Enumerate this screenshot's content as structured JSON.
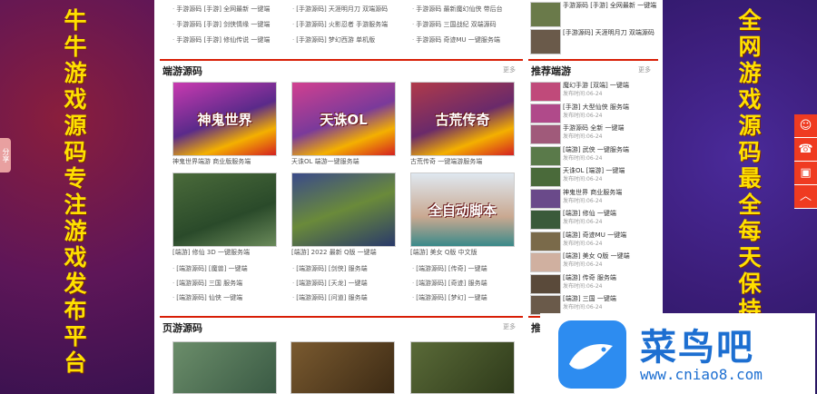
{
  "left_ad": "牛牛游戏源码专注游戏发布平台",
  "right_ad": "全网游戏源码最全每天保持",
  "share_label": "分享",
  "top_list": [
    "手游源码 [手游] 全网最新 一键端",
    "[手游源码] 天涯明月刀 双端源码",
    "手游源码 最新魔幻仙侠 带后台",
    "手游源码 [手游] 剑侠情缘 一键端",
    "[手游源码] 火影忍者 手游服务端",
    "手游源码 三国战纪 双端源码",
    "手游源码 [手游] 修仙传说 一键端",
    "[手游源码] 梦幻西游 单机版",
    "手游源码 奇迹MU 一键服务端"
  ],
  "section1": {
    "title": "端游源码",
    "more": "更多",
    "thumbs": [
      {
        "name": "神鬼世界",
        "caption": "神鬼世界端游 商业版服务端"
      },
      {
        "name": "天诛OL",
        "caption": "天诛OL 端游一键服务端"
      },
      {
        "name": "古荒传奇",
        "caption": "古荒传奇 一键端游服务端"
      },
      {
        "name": "",
        "caption": "[端游] 修仙 3D 一键服务端"
      },
      {
        "name": "",
        "caption": "[端游] 2022 最新 Q版 一键端"
      },
      {
        "name": "全自动脚本",
        "caption": "[端游] 美女 Q版 中文版"
      }
    ]
  },
  "section1_list": [
    "[端游源码] [魔兽] 一键端",
    "[端游源码] [剑侠] 服务端",
    "[端游源码] [传奇] 一键端",
    "[端游源码] 三国 服务端",
    "[端游源码] [天龙] 一键端",
    "[端游源码] [奇迹] 服务端",
    "[端游源码] 仙侠 一键端",
    "[端游源码] [问道] 服务端",
    "[端游源码] [梦幻] 一键端"
  ],
  "section2": {
    "title": "页游源码",
    "more": "更多"
  },
  "side": {
    "title": "推荐端游",
    "title2": "推荐",
    "items": [
      {
        "t": "魔幻手游 [双端] 一键端",
        "s": "发布时间:06-24"
      },
      {
        "t": "[手游] 大型仙侠 服务端",
        "s": "发布时间:06-24"
      },
      {
        "t": "手游源码 全新 一键端",
        "s": "发布时间:06-24"
      },
      {
        "t": "[端游] 武侠 一键服务端",
        "s": "发布时间:06-24"
      },
      {
        "t": "天诛OL [端游] 一键端",
        "s": "发布时间:06-24"
      },
      {
        "t": "神鬼世界 商业服务端",
        "s": "发布时间:06-24"
      },
      {
        "t": "[端游] 修仙 一键端",
        "s": "发布时间:06-24"
      },
      {
        "t": "[端游] 奇迹MU 一键端",
        "s": "发布时间:06-24"
      },
      {
        "t": "[端游] 美女 Q版 一键端",
        "s": "发布时间:06-24"
      },
      {
        "t": "[端游] 传奇 服务端",
        "s": "发布时间:06-24"
      },
      {
        "t": "[端游] 三国 一键端",
        "s": "发布时间:06-24"
      }
    ]
  },
  "float_icons": [
    "chat-icon",
    "phone-icon",
    "message-icon",
    "up-icon"
  ],
  "watermark": {
    "title": "菜鸟吧",
    "url": "www.cniao8.com"
  },
  "colors": {
    "accent": "#d81e06",
    "float": "#ef3b21",
    "yellow": "#ffe000"
  }
}
